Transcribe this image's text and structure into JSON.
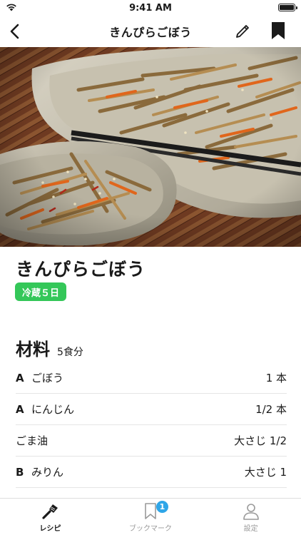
{
  "status_bar": {
    "time": "9:41 AM"
  },
  "nav": {
    "title": "きんぴらごぼう"
  },
  "recipe": {
    "title": "きんぴらごぼう",
    "storage_badge": "冷蔵５日"
  },
  "ingredients": {
    "heading": "材料",
    "servings": "5食分",
    "items": [
      {
        "group": "A",
        "name": "ごぼう",
        "amount": "1 本"
      },
      {
        "group": "A",
        "name": "にんじん",
        "amount": "1/2 本"
      },
      {
        "group": "",
        "name": "ごま油",
        "amount": "大さじ 1/2"
      },
      {
        "group": "B",
        "name": "みりん",
        "amount": "大さじ 1"
      }
    ]
  },
  "tab_bar": {
    "tabs": [
      {
        "label": "レシピ",
        "icon": "spatula-icon",
        "active": true
      },
      {
        "label": "ブックマーク",
        "icon": "bookmark-icon",
        "badge": "1"
      },
      {
        "label": "設定",
        "icon": "person-icon"
      }
    ]
  },
  "colors": {
    "badge_green": "#34c759",
    "tab_badge_blue": "#2fa6e8"
  }
}
